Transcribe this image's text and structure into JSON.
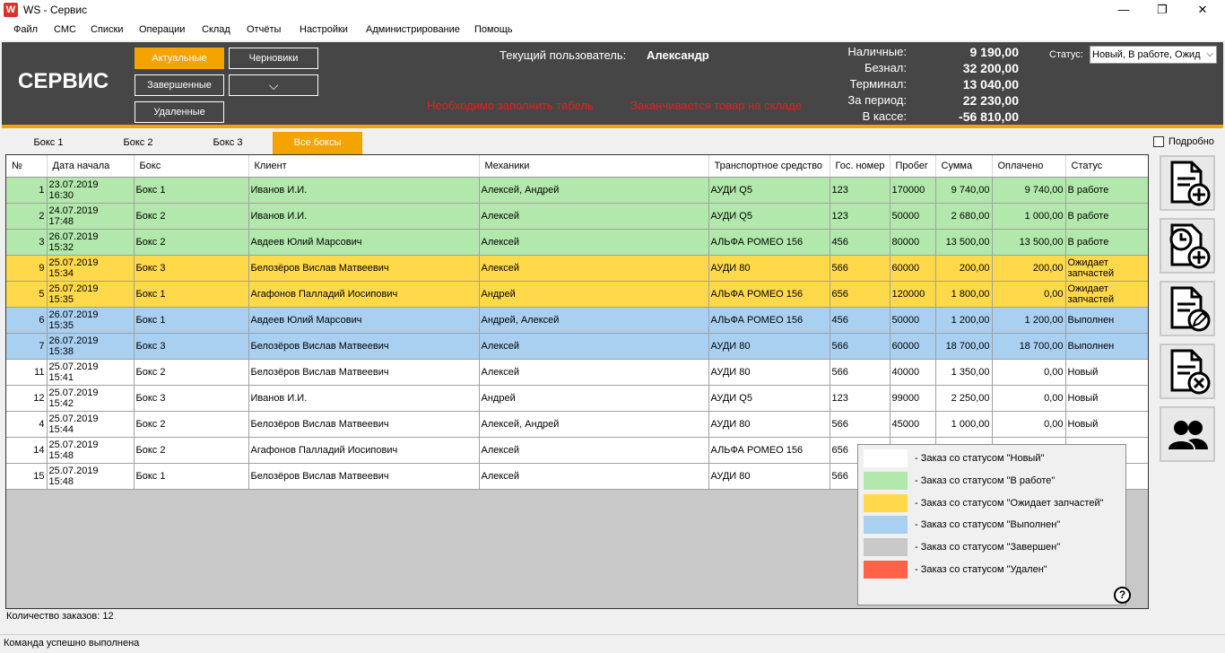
{
  "window": {
    "title": "WS - Сервис",
    "app_icon": "W",
    "minimize": "—",
    "maximize": "❐",
    "close": "✕"
  },
  "menu": [
    "Файл",
    "СМС",
    "Списки",
    "Операции",
    "Склад",
    "Отчёты",
    "Настройки",
    "Администрирование",
    "Помощь"
  ],
  "header": {
    "title": "СЕРВИС",
    "filters": {
      "actual": "Актуальные",
      "drafts": "Черновики",
      "completed": "Завершенные",
      "deleted": "Удаленные",
      "dropdown": "⌵"
    },
    "current_user_label": "Текущий пользователь:",
    "current_user": "Александр",
    "warnings": [
      "Необходимо заполнить табель",
      "Заканчивается товар на складе"
    ],
    "totals": [
      {
        "label": "Наличные:",
        "value": "9 190,00"
      },
      {
        "label": "Безнал:",
        "value": "32 200,00"
      },
      {
        "label": "Терминал:",
        "value": "13 040,00"
      },
      {
        "label": "За период:",
        "value": "22 230,00"
      },
      {
        "label": "В кассе:",
        "value": "-56 810,00"
      }
    ],
    "status_label": "Статус:",
    "status_value": "Новый, В работе, Ожид"
  },
  "tabs": [
    "Бокс 1",
    "Бокс 2",
    "Бокс 3",
    "Все боксы"
  ],
  "active_tab": "Все боксы",
  "detail_label": "Подробно",
  "columns": [
    "№",
    "Дата начала",
    "Бокс",
    "Клиент",
    "Механики",
    "Транспортное средство",
    "Гос. номер",
    "Пробег",
    "Сумма",
    "Оплачено",
    "Статус"
  ],
  "rows": [
    {
      "status_class": "st-work",
      "cells": [
        "1",
        "23.07.2019\n16:30",
        "Бокс 1",
        "Иванов И.И.",
        "Алексей, Андрей",
        "АУДИ Q5",
        "123",
        "170000",
        "9 740,00",
        "9 740,00",
        "В работе"
      ]
    },
    {
      "status_class": "st-work",
      "cells": [
        "2",
        "24.07.2019\n17:48",
        "Бокс 2",
        "Иванов И.И.",
        "Алексей",
        "АУДИ Q5",
        "123",
        "50000",
        "2 680,00",
        "1 000,00",
        "В работе"
      ]
    },
    {
      "status_class": "st-work",
      "cells": [
        "3",
        "26.07.2019\n15:32",
        "Бокс 2",
        "Авдеев Юлий Марсович",
        "Алексей",
        "АЛЬФА РОМЕО 156",
        "456",
        "80000",
        "13 500,00",
        "13 500,00",
        "В работе"
      ]
    },
    {
      "status_class": "st-wait",
      "cells": [
        "9",
        "25.07.2019\n15:34",
        "Бокс 3",
        "Белозёров Вислав Матвеевич",
        "Алексей",
        "АУДИ 80",
        "566",
        "60000",
        "200,00",
        "200,00",
        "Ожидает\nзапчастей"
      ]
    },
    {
      "status_class": "st-wait",
      "cells": [
        "5",
        "25.07.2019\n15:35",
        "Бокс 1",
        "Агафонов Палладий Иосипович",
        "Андрей",
        "АЛЬФА РОМЕО 156",
        "656",
        "120000",
        "1 800,00",
        "0,00",
        "Ожидает\nзапчастей"
      ]
    },
    {
      "status_class": "st-done",
      "cells": [
        "6",
        "26.07.2019\n15:35",
        "Бокс 1",
        "Авдеев Юлий Марсович",
        "Андрей, Алексей",
        "АЛЬФА РОМЕО 156",
        "456",
        "50000",
        "1 200,00",
        "1 200,00",
        "Выполнен"
      ]
    },
    {
      "status_class": "st-done",
      "cells": [
        "7",
        "26.07.2019\n15:38",
        "Бокс 3",
        "Белозёров Вислав Матвеевич",
        "Алексей",
        "АУДИ 80",
        "566",
        "60000",
        "18 700,00",
        "18 700,00",
        "Выполнен"
      ]
    },
    {
      "status_class": "st-new",
      "cells": [
        "11",
        "25.07.2019\n15:41",
        "Бокс 2",
        "Белозёров Вислав Матвеевич",
        "Алексей",
        "АУДИ 80",
        "566",
        "40000",
        "1 350,00",
        "0,00",
        "Новый"
      ]
    },
    {
      "status_class": "st-new",
      "cells": [
        "12",
        "25.07.2019\n15:42",
        "Бокс 3",
        "Иванов И.И.",
        "Андрей",
        "АУДИ Q5",
        "123",
        "99000",
        "2 250,00",
        "0,00",
        "Новый"
      ]
    },
    {
      "status_class": "st-new",
      "cells": [
        "4",
        "25.07.2019\n15:44",
        "Бокс 2",
        "Белозёров Вислав Матвеевич",
        "Алексей, Андрей",
        "АУДИ 80",
        "566",
        "45000",
        "1 000,00",
        "0,00",
        "Новый"
      ]
    },
    {
      "status_class": "st-new",
      "cells": [
        "14",
        "25.07.2019\n15:48",
        "Бокс 2",
        "Агафонов Палладий Иосипович",
        "Алексей",
        "АЛЬФА РОМЕО 156",
        "656",
        "",
        "",
        "",
        ""
      ]
    },
    {
      "status_class": "st-new",
      "cells": [
        "15",
        "25.07.2019\n15:48",
        "Бокс 1",
        "Белозёров Вислав Матвеевич",
        "Алексей",
        "АУДИ 80",
        "566",
        "",
        "",
        "",
        ""
      ]
    }
  ],
  "legend": [
    {
      "color": "#ffffff",
      "text": "-  Заказ со статусом \"Новый\""
    },
    {
      "color": "#b2e8ac",
      "text": "-  Заказ со статусом \"В работе\""
    },
    {
      "color": "#ffd94a",
      "text": "-  Заказ со статусом \"Ожидает запчастей\""
    },
    {
      "color": "#a9d0f1",
      "text": "-  Заказ со статусом \"Выполнен\""
    },
    {
      "color": "#c8c8c8",
      "text": "-  Заказ со статусом \"Завершен\""
    },
    {
      "color": "#ff6347",
      "text": "-  Заказ со статусом \"Удален\""
    }
  ],
  "help": "?",
  "side_buttons": [
    "new-order-icon",
    "scheduled-order-icon",
    "edit-order-icon",
    "delete-order-icon",
    "clients-icon"
  ],
  "order_count": "Количество заказов: 12",
  "status_bar": "Команда успешно выполнена"
}
